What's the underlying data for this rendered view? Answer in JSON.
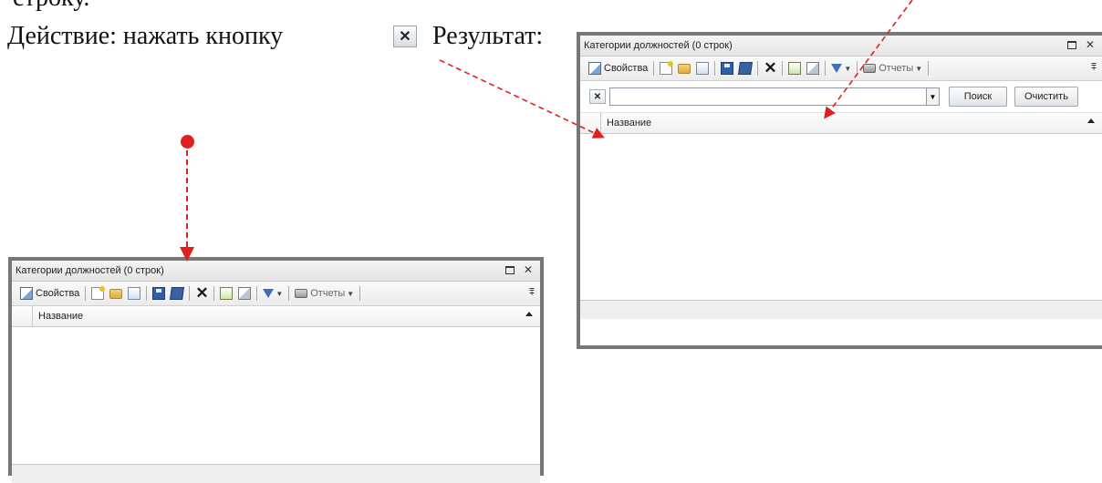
{
  "document": {
    "top_text": "строку.",
    "action_text": "Действие: нажать кнопку",
    "result_text": "Результат:"
  },
  "window": {
    "title": "Категории должностей (0 строк)",
    "toolbar": {
      "properties_label": "Свойства",
      "reports_label": "Отчеты"
    },
    "grid": {
      "column_name": "Название"
    }
  },
  "search": {
    "value": "",
    "search_label": "Поиск",
    "clear_label": "Очистить"
  },
  "colors": {
    "annotation_red": "#e02020",
    "window_border": "#777777"
  }
}
